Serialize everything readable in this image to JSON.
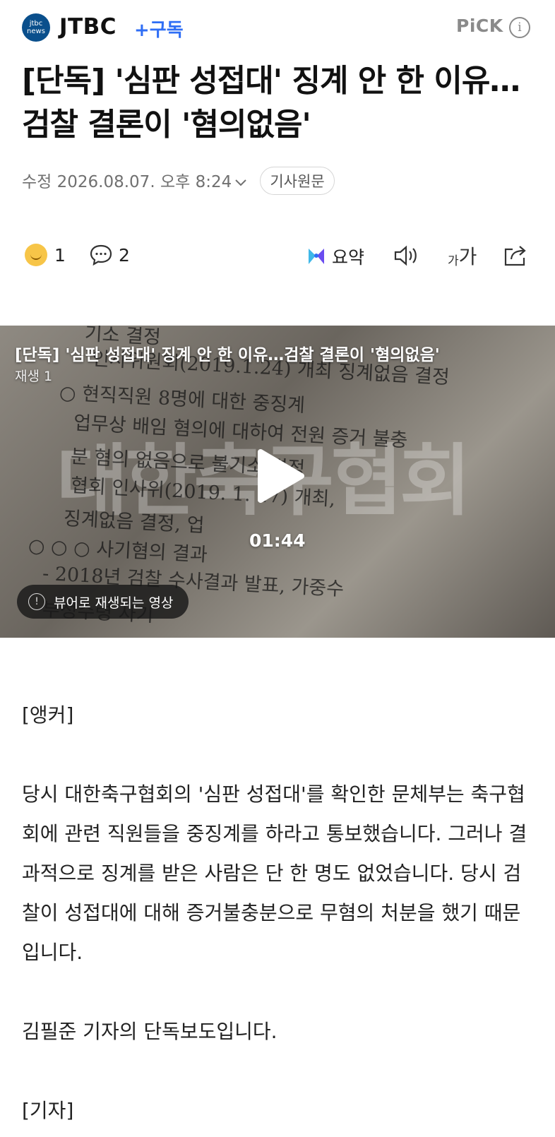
{
  "header": {
    "logo_text_top": "jtbc",
    "logo_text_bottom": "news",
    "brand": "JTBC",
    "subscribe_label": "+구독",
    "pick_label": "PiCK",
    "info_label": "i"
  },
  "article": {
    "title": "[단독] '심판 성접대' 징계 안 한 이유…검찰 결론이 '혐의없음'",
    "timestamp": "수정 2026.08.07. 오후 8:24",
    "original_button": "기사원문"
  },
  "actions": {
    "reaction_count": "1",
    "comment_count": "2",
    "summary_label": "요약",
    "font_label_small": "가",
    "font_label_large": "가"
  },
  "video": {
    "title": "[단독] '심판 성접대' 징계 안 한 이유…검찰 결론이 '혐의없음'",
    "views": "재생 1",
    "duration": "01:44",
    "viewer_notice": "뷰어로 재생되는 영상",
    "watermark": "대한축구협회",
    "doc_lines": [
      "기소 결정",
      "인사위원회(2019.1.24) 개최 징계없음 결정",
      "○ 현직직원 8명에 대한 중징계",
      "업무상 배임 혐의에 대하여 전원 증거 불충",
      "분 혐의 없음으로 불기소 결정",
      "협회 인사위(2019. 1. 17) 개최,",
      "징계없음 결정, 업",
      "○ ○ ○ 사기혐의 결과",
      "- 2018년 검찰 수사결과 발표, 가중수",
      "부정수령 사기"
    ]
  },
  "body": {
    "paragraphs": [
      "[앵커]",
      "당시 대한축구협회의 '심판 성접대'를 확인한 문체부는 축구협회에 관련 직원들을 중징계를 하라고 통보했습니다. 그러나 결과적으로 징계를 받은 사람은 단 한 명도 없었습니다. 당시 검찰이 성접대에 대해 증거불충분으로 무혐의 처분을 했기 때문입니다.",
      "김필준 기자의 단독보도입니다.",
      "[기자]"
    ]
  },
  "colors": {
    "accent": "#2f6ef5",
    "logo": "#0a4f8c"
  }
}
